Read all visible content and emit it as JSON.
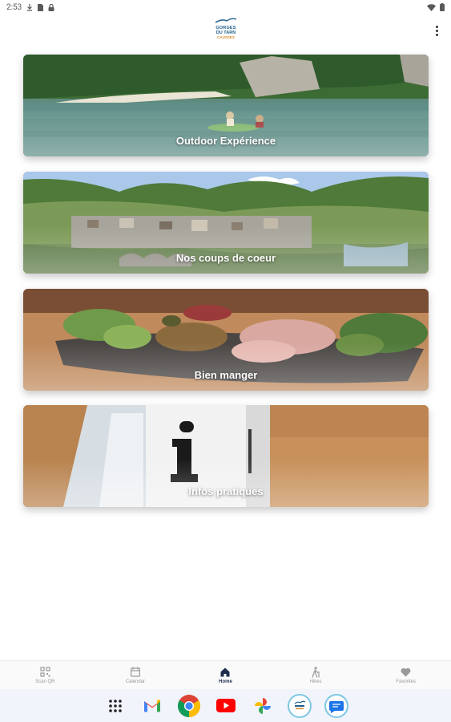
{
  "status_bar": {
    "time": "2:53",
    "icons": [
      "download-icon",
      "sim-card-icon",
      "lock-icon",
      "wifi-icon",
      "battery-icon"
    ]
  },
  "header": {
    "logo": {
      "line1": "GORGES",
      "line2": "DU TARN",
      "line3": "CAUSSES"
    },
    "menu_icon": "more-vertical-icon"
  },
  "cards": [
    {
      "title": "Outdoor Expérience",
      "image": "river-kayak-photo"
    },
    {
      "title": "Nos coups de coeur",
      "image": "village-valley-photo"
    },
    {
      "title": "Bien manger",
      "image": "charcuterie-board-photo"
    },
    {
      "title": "Infos pratiques",
      "image": "info-sign-photo"
    }
  ],
  "bottom_nav": {
    "active": "Home",
    "items": [
      {
        "label": "Scan QR",
        "icon": "qr-code-icon"
      },
      {
        "label": "Calendar",
        "icon": "calendar-icon"
      },
      {
        "label": "Home",
        "icon": "home-icon"
      },
      {
        "label": "Hikes",
        "icon": "hiking-icon"
      },
      {
        "label": "Favorites",
        "icon": "heart-icon"
      }
    ]
  },
  "taskbar": {
    "apps": [
      "app-grid-icon",
      "gmail-icon",
      "chrome-icon",
      "youtube-icon",
      "photos-icon",
      "gorges-du-tarn-app-icon",
      "messages-icon"
    ]
  },
  "colors": {
    "brand_blue": "#1f5f8b",
    "brand_orange": "#e08a2b",
    "nav_active": "#1f2d4d",
    "nav_inactive": "#9a9a9a",
    "taskbar_bg": "#f1f4fb"
  }
}
